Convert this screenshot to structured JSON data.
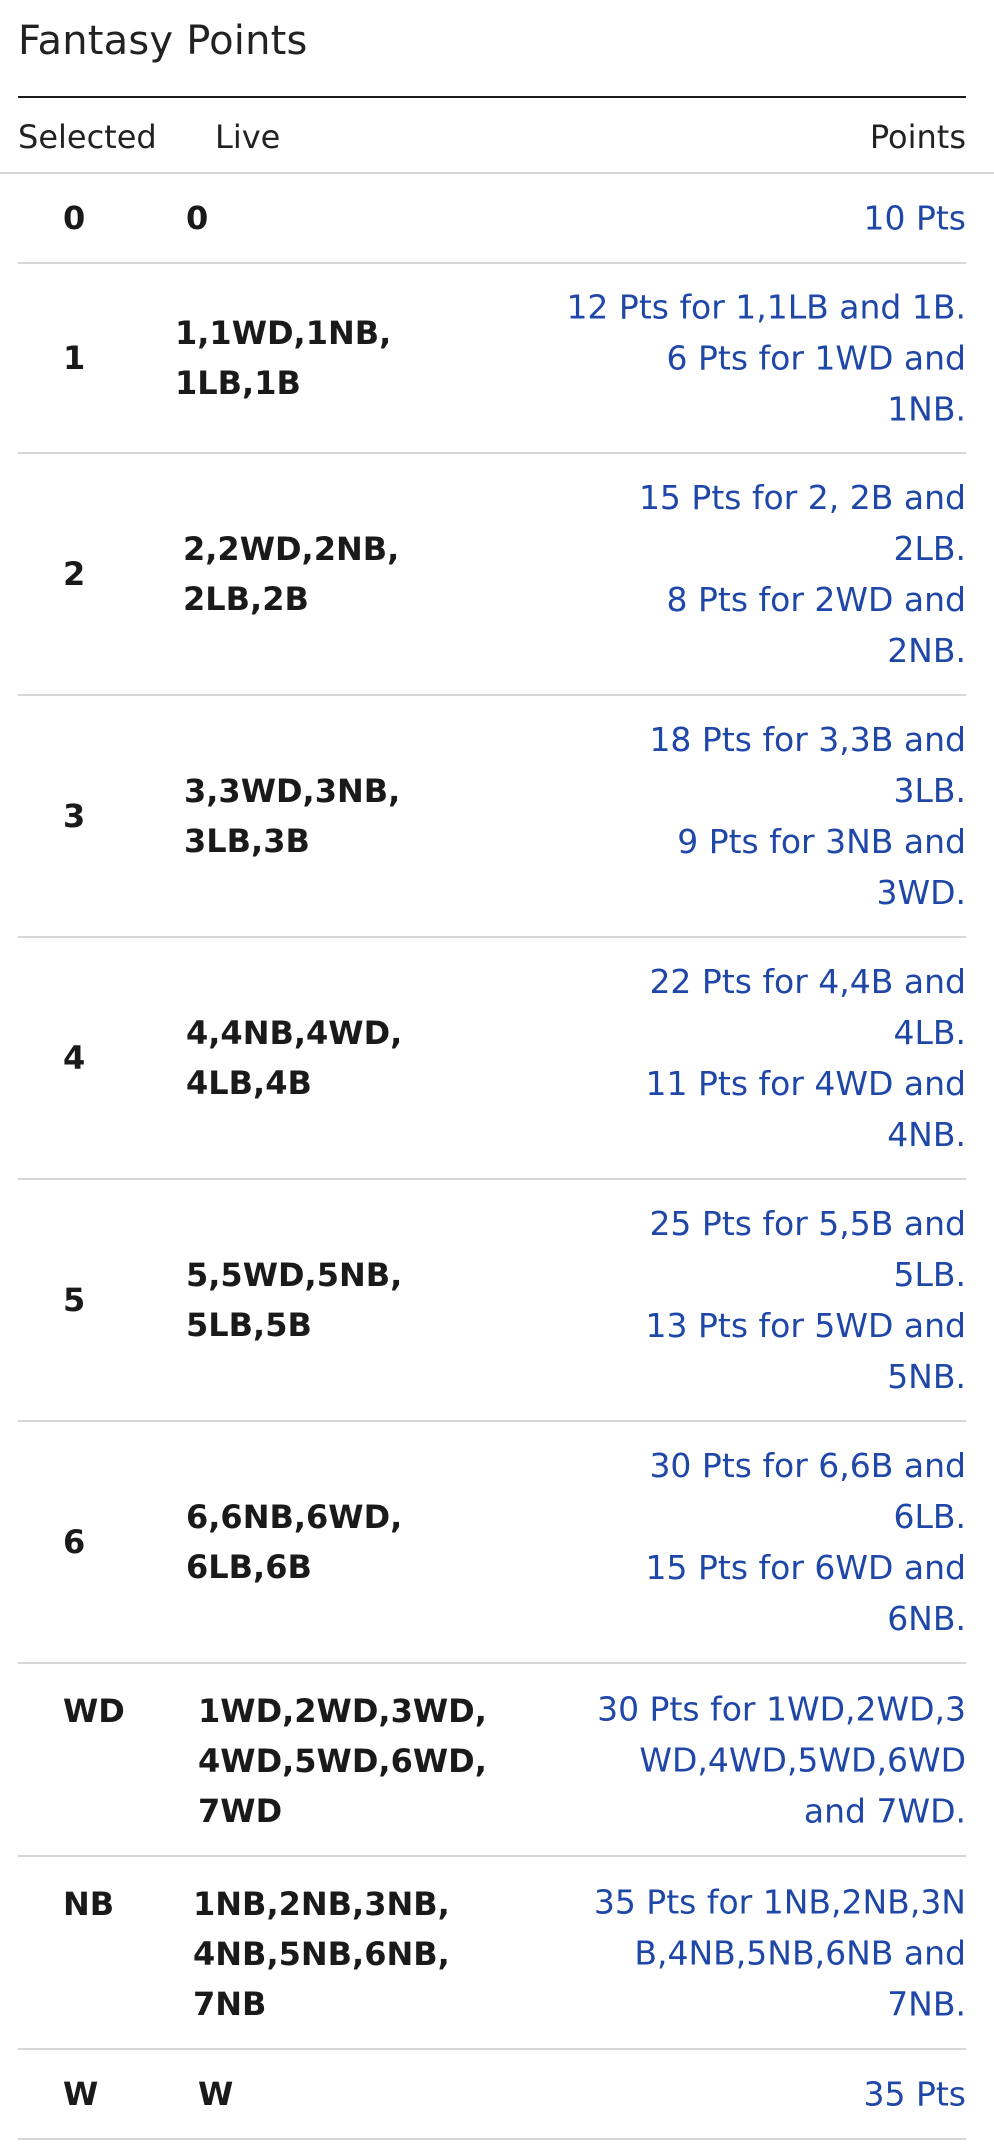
{
  "title": "Fantasy Points",
  "headers": {
    "selected": "Selected",
    "live": "Live",
    "points": "Points"
  },
  "rows": [
    {
      "selected": "0",
      "live": "0",
      "points": "10 Pts"
    },
    {
      "selected": "1",
      "live": "1,1WD,1NB,\n1LB,1B",
      "points": "12 Pts for 1,1LB and 1B.\n6 Pts for 1WD and\n1NB."
    },
    {
      "selected": "2",
      "live": "2,2WD,2NB,\n2LB,2B",
      "points": "15 Pts for 2, 2B and\n2LB.\n8 Pts for 2WD and\n2NB."
    },
    {
      "selected": "3",
      "live": "3,3WD,3NB,\n3LB,3B",
      "points": "18 Pts for 3,3B and\n3LB.\n9 Pts for 3NB and\n3WD."
    },
    {
      "selected": "4",
      "live": "4,4NB,4WD,\n4LB,4B",
      "points": "22 Pts for 4,4B and\n4LB.\n11 Pts for 4WD and\n4NB."
    },
    {
      "selected": "5",
      "live": "5,5WD,5NB,\n5LB,5B",
      "points": "25 Pts for 5,5B and\n5LB.\n13 Pts for 5WD and\n5NB."
    },
    {
      "selected": "6",
      "live": "6,6NB,6WD,\n6LB,6B",
      "points": "30 Pts for 6,6B and\n6LB.\n15 Pts for 6WD and\n6NB."
    },
    {
      "selected": "WD",
      "live": "1WD,2WD,3WD,\n4WD,5WD,6WD,\n7WD",
      "points": "30 Pts for 1WD,2WD,3\nWD,4WD,5WD,6WD\nand 7WD."
    },
    {
      "selected": "NB",
      "live": "1NB,2NB,3NB,\n4NB,5NB,6NB,\n7NB",
      "points": "35 Pts for 1NB,2NB,3N\nB,4NB,5NB,6NB and\n7NB."
    },
    {
      "selected": "W",
      "live": "W",
      "points": "35 Pts"
    }
  ]
}
